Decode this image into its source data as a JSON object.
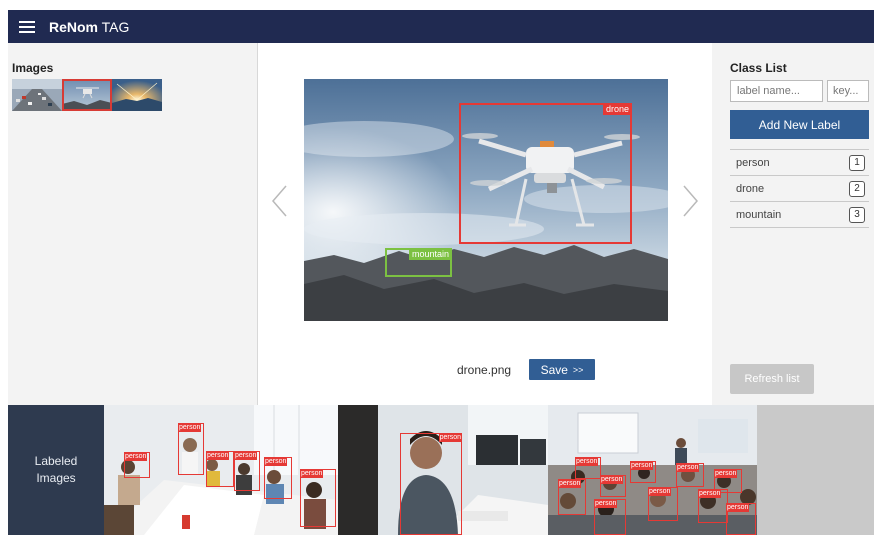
{
  "header": {
    "brand_bold": "ReNom",
    "brand_rest": " TAG"
  },
  "left_panel": {
    "title": "Images"
  },
  "main": {
    "filename": "drone.png",
    "save_label": "Save",
    "save_arrows": ">>",
    "annotations": {
      "drone": "drone",
      "mountain": "mountain"
    }
  },
  "right_panel": {
    "title": "Class List",
    "label_placeholder": "label name...",
    "key_placeholder": "key...",
    "add_label": "Add New Label",
    "classes": [
      {
        "name": "person",
        "key": "1"
      },
      {
        "name": "drone",
        "key": "2"
      },
      {
        "name": "mountain",
        "key": "3"
      }
    ],
    "refresh_label": "Refresh list"
  },
  "bottom": {
    "title_line1": "Labeled",
    "title_line2": "Images",
    "person_tag": "person"
  },
  "colors": {
    "header": "#202a51",
    "primary_button": "#315e94",
    "bbox_red": "#e53935",
    "bbox_green": "#7cc142",
    "labeled_panel": "#2e3a4f"
  }
}
